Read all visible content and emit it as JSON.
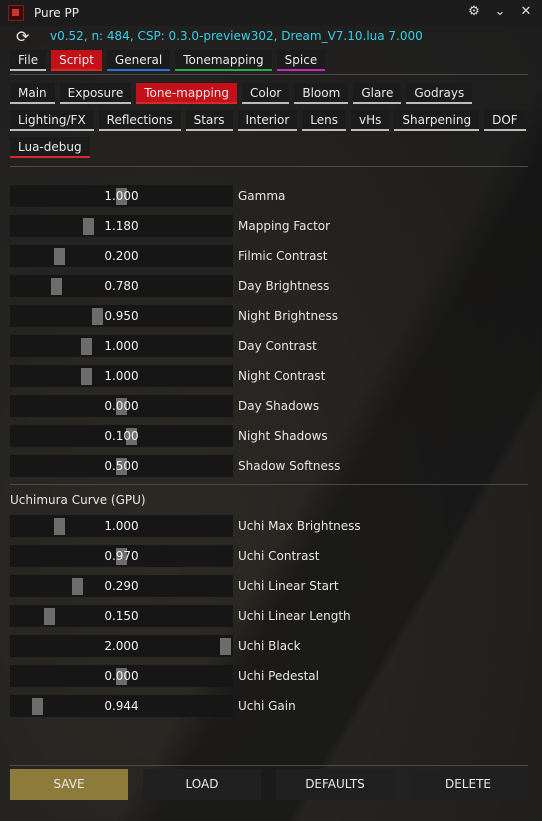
{
  "window": {
    "title": "Pure PP"
  },
  "titlebar_icons": [
    "settings-icon",
    "chevron-down-icon",
    "close-icon"
  ],
  "info": {
    "text": "v0.52, n: 484, CSP: 0.3.0-preview302, Dream_V7.10.lua 7.000"
  },
  "main_tabs": [
    {
      "label": "File"
    },
    {
      "label": "Script"
    },
    {
      "label": "General"
    },
    {
      "label": "Tonemapping"
    },
    {
      "label": "Spice"
    }
  ],
  "sub_tabs_row1": [
    {
      "label": "Main"
    },
    {
      "label": "Exposure"
    },
    {
      "label": "Tone-mapping"
    },
    {
      "label": "Color"
    },
    {
      "label": "Bloom"
    },
    {
      "label": "Glare"
    },
    {
      "label": "Godrays"
    }
  ],
  "sub_tabs_row2": [
    {
      "label": "Lighting/FX"
    },
    {
      "label": "Reflections"
    },
    {
      "label": "Stars"
    },
    {
      "label": "Interior"
    },
    {
      "label": "Lens"
    },
    {
      "label": "vHs"
    },
    {
      "label": "Sharpening"
    },
    {
      "label": "DOF"
    }
  ],
  "sub_tabs_row3": [
    {
      "label": "Lua-debug"
    }
  ],
  "sliders": [
    {
      "label": "Gamma",
      "value": "1.000"
    },
    {
      "label": "Mapping Factor",
      "value": "1.180"
    },
    {
      "label": "Filmic Contrast",
      "value": "0.200"
    },
    {
      "label": "Day Brightness",
      "value": "0.780"
    },
    {
      "label": "Night Brightness",
      "value": "0.950"
    },
    {
      "label": "Day Contrast",
      "value": "1.000"
    },
    {
      "label": "Night Contrast",
      "value": "1.000"
    },
    {
      "label": "Day Shadows",
      "value": "0.000"
    },
    {
      "label": "Night Shadows",
      "value": "0.100"
    },
    {
      "label": "Shadow Softness",
      "value": "0.500"
    }
  ],
  "uchimura": {
    "title": "Uchimura Curve (GPU)",
    "sliders": [
      {
        "label": "Uchi Max Brightness",
        "value": "1.000"
      },
      {
        "label": "Uchi Contrast",
        "value": "0.970"
      },
      {
        "label": "Uchi Linear Start",
        "value": "0.290"
      },
      {
        "label": "Uchi Linear Length",
        "value": "0.150"
      },
      {
        "label": "Uchi Black",
        "value": "2.000"
      },
      {
        "label": "Uchi Pedestal",
        "value": "0.000"
      },
      {
        "label": "Uchi Gain",
        "value": "0.944"
      }
    ]
  },
  "buttons": {
    "save": "SAVE",
    "load": "LOAD",
    "defaults": "DEFAULTS",
    "delete": "DELETE"
  },
  "colors": {
    "active_tab": "#c41018",
    "info_text": "#35d0e8",
    "save_button": "#8c7b3a"
  }
}
